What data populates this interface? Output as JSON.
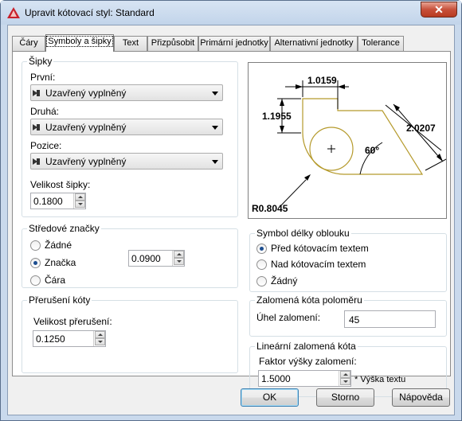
{
  "window": {
    "title": "Upravit kótovací styl: Standard",
    "close": "✕"
  },
  "tabs": [
    "Čáry",
    "Symboly a šipky",
    "Text",
    "Přizpůsobit",
    "Primární jednotky",
    "Alternativní jednotky",
    "Tolerance"
  ],
  "arrows": {
    "title": "Šipky",
    "first_label": "První:",
    "first_value": "Uzavřený vyplněný",
    "second_label": "Druhá:",
    "second_value": "Uzavřený vyplněný",
    "leader_label": "Pozice:",
    "leader_value": "Uzavřený vyplněný",
    "size_label": "Velikost šipky:",
    "size_value": "0.1800"
  },
  "center": {
    "title": "Středové značky",
    "none": "Žádné",
    "mark": "Značka",
    "line": "Čára",
    "value": "0.0900"
  },
  "break": {
    "title": "Přerušení kóty",
    "size_label": "Velikost přerušení:",
    "size_value": "0.1250"
  },
  "preview": {
    "top_dim": "1.0159",
    "left_dim": "1.1955",
    "right_dim": "2.0207",
    "angle": "60°",
    "radius": "R0.8045"
  },
  "arc": {
    "title": "Symbol délky oblouku",
    "before": "Před kótovacím textem",
    "above": "Nad kótovacím textem",
    "none": "Žádný"
  },
  "jog_radius": {
    "title": "Zalomená kóta poloměru",
    "angle_label": "Úhel zalomení:",
    "angle_value": "45"
  },
  "jog_linear": {
    "title": "Lineární zalomená kóta",
    "factor_label": "Faktor výšky zalomení:",
    "factor_value": "1.5000",
    "suffix": "* Výška textu"
  },
  "buttons": {
    "ok": "OK",
    "cancel": "Storno",
    "help": "Nápověda"
  }
}
